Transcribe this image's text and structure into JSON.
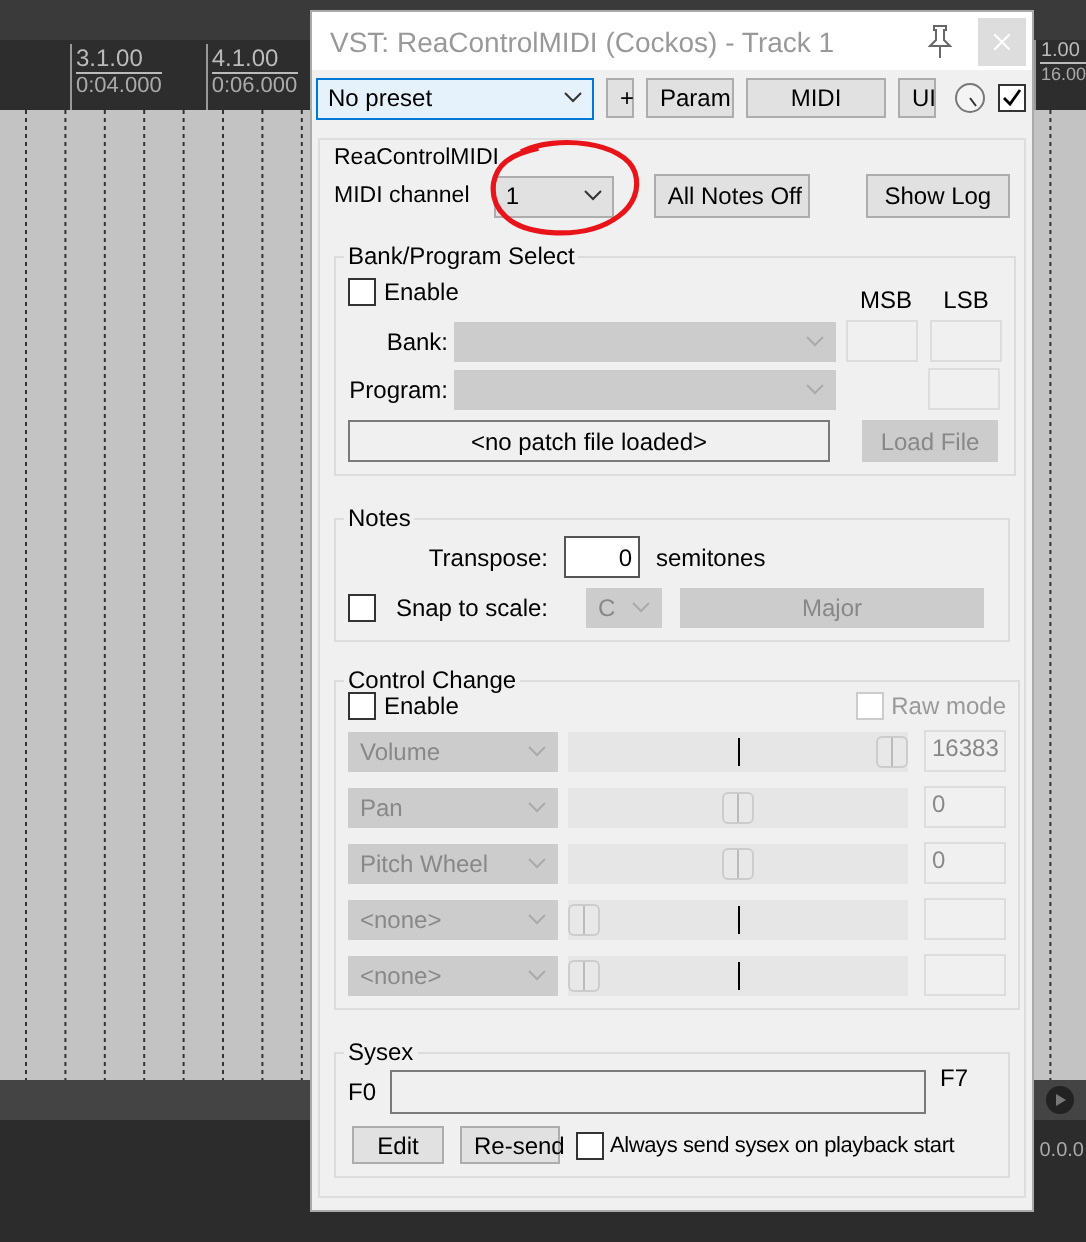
{
  "background": {
    "ruler": [
      {
        "bar": "3.1.00",
        "time": "0:04.000"
      },
      {
        "bar": "4.1.00",
        "time": "0:06.000"
      }
    ],
    "ruler_right": {
      "bar": "1.00",
      "time": "16.00"
    },
    "status_text": "0.0.0"
  },
  "dialog": {
    "title": "VST: ReaControlMIDI (Cockos) - Track 1",
    "toolbar": {
      "preset": "No preset",
      "buttons": [
        "+",
        "Param",
        "MIDI",
        "UI"
      ],
      "enabled": true
    },
    "main": {
      "title": "ReaControlMIDI",
      "midi_channel_label": "MIDI channel",
      "midi_channel": "1",
      "buttons": [
        "All Notes Off",
        "Show Log"
      ],
      "highlighted": true
    },
    "bank": {
      "title": "Bank/Program Select",
      "enable": {
        "label": "Enable",
        "checked": false
      },
      "msb_label": "MSB",
      "lsb_label": "LSB",
      "bank_label": "Bank:",
      "program_label": "Program:",
      "patch_file": "<no patch file loaded>",
      "load_button": {
        "label": "Load File",
        "disabled": true
      }
    },
    "notes": {
      "title": "Notes",
      "transpose_label": "Transpose:",
      "transpose": "0",
      "semitones_label": "semitones",
      "snap": {
        "label": "Snap to scale:",
        "checked": false
      },
      "root": "C",
      "scale": "Major"
    },
    "control_change": {
      "title": "Control Change",
      "enable": {
        "label": "Enable",
        "checked": false
      },
      "raw_mode": {
        "label": "Raw mode",
        "checked": false,
        "disabled": true
      },
      "rows": [
        {
          "controller": "Volume",
          "level": 1,
          "value": "16383"
        },
        {
          "controller": "Pan",
          "level": 0.5,
          "value": "0"
        },
        {
          "controller": "Pitch Wheel",
          "level": 0.5,
          "value": "0"
        },
        {
          "controller": "<none>",
          "level": 0
        },
        {
          "controller": "<none>",
          "level": 0
        }
      ]
    },
    "sysex": {
      "title": "Sysex",
      "prefix": "F0",
      "suffix": "F7",
      "buttons": [
        "Edit",
        "Re-send"
      ],
      "always_send": {
        "label": "Always send sysex on playback start",
        "checked": false
      }
    }
  }
}
